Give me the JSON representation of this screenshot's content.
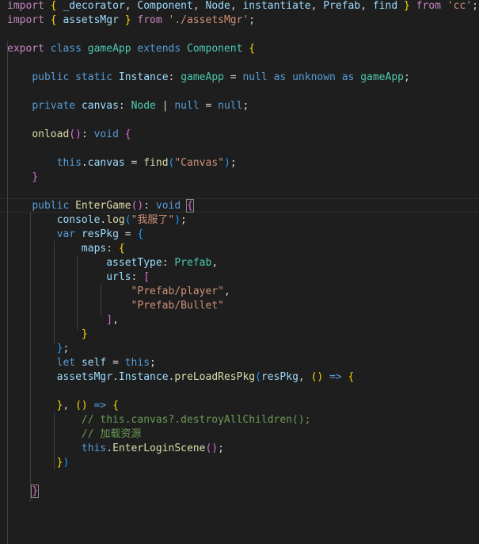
{
  "editor": {
    "language": "typescript",
    "theme_background": "#1e1e1e",
    "lines": [
      [
        [
          "import",
          "ctl"
        ],
        [
          " ",
          ""
        ],
        [
          "{",
          "p1"
        ],
        [
          " ",
          ""
        ],
        [
          "_decorator",
          "var"
        ],
        [
          ", ",
          ""
        ],
        [
          "Component",
          "var"
        ],
        [
          ", ",
          ""
        ],
        [
          "Node",
          "var"
        ],
        [
          ", ",
          ""
        ],
        [
          "instantiate",
          "var"
        ],
        [
          ", ",
          ""
        ],
        [
          "Prefab",
          "var"
        ],
        [
          ", ",
          ""
        ],
        [
          "find",
          "var"
        ],
        [
          " ",
          ""
        ],
        [
          "}",
          "p1"
        ],
        [
          " ",
          ""
        ],
        [
          "from",
          "ctl"
        ],
        [
          " ",
          ""
        ],
        [
          "'cc'",
          "str"
        ],
        [
          ";",
          ""
        ]
      ],
      [
        [
          "import",
          "ctl"
        ],
        [
          " ",
          ""
        ],
        [
          "{",
          "p1"
        ],
        [
          " ",
          ""
        ],
        [
          "assetsMgr",
          "var"
        ],
        [
          " ",
          ""
        ],
        [
          "}",
          "p1"
        ],
        [
          " ",
          ""
        ],
        [
          "from",
          "ctl"
        ],
        [
          " ",
          ""
        ],
        [
          "'./assetsMgr'",
          "str"
        ],
        [
          ";",
          ""
        ]
      ],
      [],
      [
        [
          "export",
          "ctl"
        ],
        [
          " ",
          ""
        ],
        [
          "class",
          "kw"
        ],
        [
          " ",
          ""
        ],
        [
          "gameApp",
          "cls"
        ],
        [
          " ",
          ""
        ],
        [
          "extends",
          "kw"
        ],
        [
          " ",
          ""
        ],
        [
          "Component",
          "cls"
        ],
        [
          " ",
          ""
        ],
        [
          "{",
          "p1"
        ]
      ],
      [],
      [
        [
          "    ",
          ""
        ],
        [
          "public",
          "kw"
        ],
        [
          " ",
          ""
        ],
        [
          "static",
          "kw"
        ],
        [
          " ",
          ""
        ],
        [
          "Instance",
          "var"
        ],
        [
          ": ",
          ""
        ],
        [
          "gameApp",
          "cls"
        ],
        [
          " = ",
          ""
        ],
        [
          "null",
          "kw"
        ],
        [
          " ",
          ""
        ],
        [
          "as",
          "kw"
        ],
        [
          " ",
          ""
        ],
        [
          "unknown",
          "kw"
        ],
        [
          " ",
          ""
        ],
        [
          "as",
          "kw"
        ],
        [
          " ",
          ""
        ],
        [
          "gameApp",
          "cls"
        ],
        [
          ";",
          ""
        ]
      ],
      [],
      [
        [
          "    ",
          ""
        ],
        [
          "private",
          "kw"
        ],
        [
          " ",
          ""
        ],
        [
          "canvas",
          "var"
        ],
        [
          ": ",
          ""
        ],
        [
          "Node",
          "cls"
        ],
        [
          " | ",
          ""
        ],
        [
          "null",
          "kw"
        ],
        [
          " = ",
          ""
        ],
        [
          "null",
          "kw"
        ],
        [
          ";",
          ""
        ]
      ],
      [],
      [
        [
          "    ",
          ""
        ],
        [
          "onload",
          "fn"
        ],
        [
          "()",
          "p2"
        ],
        [
          ": ",
          ""
        ],
        [
          "void",
          "kw"
        ],
        [
          " ",
          ""
        ],
        [
          "{",
          "p2"
        ]
      ],
      [],
      [
        [
          "        ",
          ""
        ],
        [
          "this",
          "kw"
        ],
        [
          ".",
          ""
        ],
        [
          "canvas",
          "var"
        ],
        [
          " = ",
          ""
        ],
        [
          "find",
          "fn"
        ],
        [
          "(",
          "p3"
        ],
        [
          "\"Canvas\"",
          "str"
        ],
        [
          ")",
          "p3"
        ],
        [
          ";",
          ""
        ]
      ],
      [
        [
          "    ",
          ""
        ],
        [
          "}",
          "p2"
        ]
      ],
      [],
      [
        [
          "    ",
          ""
        ],
        [
          "public",
          "kw"
        ],
        [
          " ",
          ""
        ],
        [
          "EnterGame",
          "fn"
        ],
        [
          "()",
          "p2"
        ],
        [
          ": ",
          ""
        ],
        [
          "void",
          "kw"
        ],
        [
          " ",
          ""
        ],
        [
          "{",
          "p2 bm"
        ]
      ],
      [
        [
          "        ",
          ""
        ],
        [
          "console",
          "var"
        ],
        [
          ".",
          ""
        ],
        [
          "log",
          "fn"
        ],
        [
          "(",
          "p3"
        ],
        [
          "\"我服了\"",
          "str"
        ],
        [
          ")",
          "p3"
        ],
        [
          ";",
          ""
        ]
      ],
      [
        [
          "        ",
          ""
        ],
        [
          "var",
          "kw"
        ],
        [
          " ",
          ""
        ],
        [
          "resPkg",
          "var"
        ],
        [
          " = ",
          ""
        ],
        [
          "{",
          "p3"
        ]
      ],
      [
        [
          "            ",
          ""
        ],
        [
          "maps",
          "var"
        ],
        [
          ": ",
          ""
        ],
        [
          "{",
          "p1"
        ]
      ],
      [
        [
          "                ",
          ""
        ],
        [
          "assetType",
          "var"
        ],
        [
          ": ",
          ""
        ],
        [
          "Prefab",
          "cls"
        ],
        [
          ",",
          ""
        ]
      ],
      [
        [
          "                ",
          ""
        ],
        [
          "urls",
          "var"
        ],
        [
          ": ",
          ""
        ],
        [
          "[",
          "p2"
        ]
      ],
      [
        [
          "                    ",
          ""
        ],
        [
          "\"Prefab/player\"",
          "str"
        ],
        [
          ",",
          ""
        ]
      ],
      [
        [
          "                    ",
          ""
        ],
        [
          "\"Prefab/Bullet\"",
          "str"
        ]
      ],
      [
        [
          "                ",
          ""
        ],
        [
          "]",
          "p2"
        ],
        [
          ",",
          ""
        ]
      ],
      [
        [
          "            ",
          ""
        ],
        [
          "}",
          "p1"
        ]
      ],
      [
        [
          "        ",
          ""
        ],
        [
          "}",
          "p3"
        ],
        [
          ";",
          ""
        ]
      ],
      [
        [
          "        ",
          ""
        ],
        [
          "let",
          "kw"
        ],
        [
          " ",
          ""
        ],
        [
          "self",
          "var"
        ],
        [
          " = ",
          ""
        ],
        [
          "this",
          "kw"
        ],
        [
          ";",
          ""
        ]
      ],
      [
        [
          "        ",
          ""
        ],
        [
          "assetsMgr",
          "var"
        ],
        [
          ".",
          ""
        ],
        [
          "Instance",
          "var"
        ],
        [
          ".",
          ""
        ],
        [
          "preLoadResPkg",
          "fn"
        ],
        [
          "(",
          "p3"
        ],
        [
          "resPkg",
          "var"
        ],
        [
          ", ",
          ""
        ],
        [
          "()",
          "p1"
        ],
        [
          " ",
          ""
        ],
        [
          "=>",
          "kw"
        ],
        [
          " ",
          ""
        ],
        [
          "{",
          "p1"
        ]
      ],
      [],
      [
        [
          "        ",
          ""
        ],
        [
          "}",
          "p1"
        ],
        [
          ", ",
          ""
        ],
        [
          "()",
          "p1"
        ],
        [
          " ",
          ""
        ],
        [
          "=>",
          "kw"
        ],
        [
          " ",
          ""
        ],
        [
          "{",
          "p1"
        ]
      ],
      [
        [
          "            ",
          ""
        ],
        [
          "// this.canvas?.destroyAllChildren();",
          "cmt"
        ]
      ],
      [
        [
          "            ",
          ""
        ],
        [
          "// 加载资源",
          "cmt"
        ]
      ],
      [
        [
          "            ",
          ""
        ],
        [
          "this",
          "kw"
        ],
        [
          ".",
          ""
        ],
        [
          "EnterLoginScene",
          "fn"
        ],
        [
          "()",
          "p2"
        ],
        [
          ";",
          ""
        ]
      ],
      [
        [
          "        ",
          ""
        ],
        [
          "}",
          "p1"
        ],
        [
          ")",
          "p3"
        ]
      ],
      [],
      [
        [
          "    ",
          ""
        ],
        [
          "}",
          "p2 bm"
        ]
      ]
    ]
  }
}
